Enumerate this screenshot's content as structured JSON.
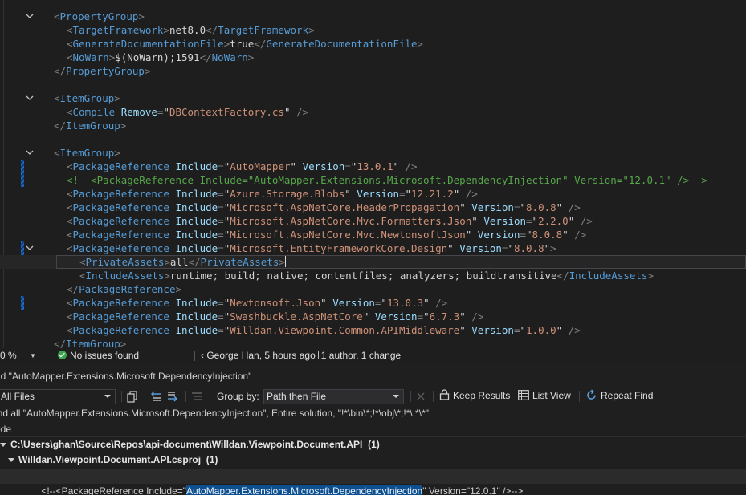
{
  "editor": {
    "lines": [
      {
        "fold": true,
        "indent": 0,
        "parts": [
          [
            "b",
            "<"
          ],
          [
            "t",
            "PropertyGroup"
          ],
          [
            "b",
            ">"
          ]
        ]
      },
      {
        "indent": 1,
        "parts": [
          [
            "b",
            "<"
          ],
          [
            "t",
            "TargetFramework"
          ],
          [
            "b",
            ">"
          ],
          [
            "x",
            "net8.0"
          ],
          [
            "b",
            "</"
          ],
          [
            "t",
            "TargetFramework"
          ],
          [
            "b",
            ">"
          ]
        ]
      },
      {
        "indent": 1,
        "parts": [
          [
            "b",
            "<"
          ],
          [
            "t",
            "GenerateDocumentationFile"
          ],
          [
            "b",
            ">"
          ],
          [
            "x",
            "true"
          ],
          [
            "b",
            "</"
          ],
          [
            "t",
            "GenerateDocumentationFile"
          ],
          [
            "b",
            ">"
          ]
        ]
      },
      {
        "indent": 1,
        "parts": [
          [
            "b",
            "<"
          ],
          [
            "t",
            "NoWarn"
          ],
          [
            "b",
            ">"
          ],
          [
            "x",
            "$(NoWarn);1591"
          ],
          [
            "b",
            "</"
          ],
          [
            "t",
            "NoWarn"
          ],
          [
            "b",
            ">"
          ]
        ]
      },
      {
        "indent": 0,
        "parts": [
          [
            "b",
            "</"
          ],
          [
            "t",
            "PropertyGroup"
          ],
          [
            "b",
            ">"
          ]
        ]
      },
      {
        "indent": 0,
        "parts": []
      },
      {
        "fold": true,
        "indent": 0,
        "parts": [
          [
            "b",
            "<"
          ],
          [
            "t",
            "ItemGroup"
          ],
          [
            "b",
            ">"
          ]
        ]
      },
      {
        "indent": 1,
        "parts": [
          [
            "b",
            "<"
          ],
          [
            "t",
            "Compile"
          ],
          [
            "x",
            " "
          ],
          [
            "a",
            "Remove"
          ],
          [
            "b",
            "="
          ],
          [
            "x",
            "\""
          ],
          [
            "v",
            "DBContextFactory.cs"
          ],
          [
            "x",
            "\""
          ],
          [
            "x",
            " "
          ],
          [
            "b",
            "/>"
          ]
        ]
      },
      {
        "indent": 0,
        "parts": [
          [
            "b",
            "</"
          ],
          [
            "t",
            "ItemGroup"
          ],
          [
            "b",
            ">"
          ]
        ]
      },
      {
        "indent": 0,
        "parts": []
      },
      {
        "fold": true,
        "indent": 0,
        "parts": [
          [
            "b",
            "<"
          ],
          [
            "t",
            "ItemGroup"
          ],
          [
            "b",
            ">"
          ]
        ]
      },
      {
        "mark": true,
        "indent": 1,
        "parts": [
          [
            "b",
            "<"
          ],
          [
            "t",
            "PackageReference"
          ],
          [
            "x",
            " "
          ],
          [
            "a",
            "Include"
          ],
          [
            "b",
            "="
          ],
          [
            "x",
            "\""
          ],
          [
            "v",
            "AutoMapper"
          ],
          [
            "x",
            "\""
          ],
          [
            "x",
            " "
          ],
          [
            "a",
            "Version"
          ],
          [
            "b",
            "="
          ],
          [
            "x",
            "\""
          ],
          [
            "v",
            "13.0.1"
          ],
          [
            "x",
            "\""
          ],
          [
            "x",
            " "
          ],
          [
            "b",
            "/>"
          ]
        ]
      },
      {
        "mark": true,
        "indent": 1,
        "parts": [
          [
            "c",
            "<!--<PackageReference Include=\"AutoMapper.Extensions.Microsoft.DependencyInjection\" Version=\"12.0.1\" />-->"
          ]
        ]
      },
      {
        "indent": 1,
        "parts": [
          [
            "b",
            "<"
          ],
          [
            "t",
            "PackageReference"
          ],
          [
            "x",
            " "
          ],
          [
            "a",
            "Include"
          ],
          [
            "b",
            "="
          ],
          [
            "x",
            "\""
          ],
          [
            "v",
            "Azure.Storage.Blobs"
          ],
          [
            "x",
            "\""
          ],
          [
            "x",
            " "
          ],
          [
            "a",
            "Version"
          ],
          [
            "b",
            "="
          ],
          [
            "x",
            "\""
          ],
          [
            "v",
            "12.21.2"
          ],
          [
            "x",
            "\""
          ],
          [
            "x",
            " "
          ],
          [
            "b",
            "/>"
          ]
        ]
      },
      {
        "indent": 1,
        "parts": [
          [
            "b",
            "<"
          ],
          [
            "t",
            "PackageReference"
          ],
          [
            "x",
            " "
          ],
          [
            "a",
            "Include"
          ],
          [
            "b",
            "="
          ],
          [
            "x",
            "\""
          ],
          [
            "v",
            "Microsoft.AspNetCore.HeaderPropagation"
          ],
          [
            "x",
            "\""
          ],
          [
            "x",
            " "
          ],
          [
            "a",
            "Version"
          ],
          [
            "b",
            "="
          ],
          [
            "x",
            "\""
          ],
          [
            "v",
            "8.0.8"
          ],
          [
            "x",
            "\""
          ],
          [
            "x",
            " "
          ],
          [
            "b",
            "/>"
          ]
        ]
      },
      {
        "indent": 1,
        "parts": [
          [
            "b",
            "<"
          ],
          [
            "t",
            "PackageReference"
          ],
          [
            "x",
            " "
          ],
          [
            "a",
            "Include"
          ],
          [
            "b",
            "="
          ],
          [
            "x",
            "\""
          ],
          [
            "v",
            "Microsoft.AspNetCore.Mvc.Formatters.Json"
          ],
          [
            "x",
            "\""
          ],
          [
            "x",
            " "
          ],
          [
            "a",
            "Version"
          ],
          [
            "b",
            "="
          ],
          [
            "x",
            "\""
          ],
          [
            "v",
            "2.2.0"
          ],
          [
            "x",
            "\""
          ],
          [
            "x",
            " "
          ],
          [
            "b",
            "/>"
          ]
        ]
      },
      {
        "indent": 1,
        "parts": [
          [
            "b",
            "<"
          ],
          [
            "t",
            "PackageReference"
          ],
          [
            "x",
            " "
          ],
          [
            "a",
            "Include"
          ],
          [
            "b",
            "="
          ],
          [
            "x",
            "\""
          ],
          [
            "v",
            "Microsoft.AspNetCore.Mvc.NewtonsoftJson"
          ],
          [
            "x",
            "\""
          ],
          [
            "x",
            " "
          ],
          [
            "a",
            "Version"
          ],
          [
            "b",
            "="
          ],
          [
            "x",
            "\""
          ],
          [
            "v",
            "8.0.8"
          ],
          [
            "x",
            "\""
          ],
          [
            "x",
            " "
          ],
          [
            "b",
            "/>"
          ]
        ]
      },
      {
        "fold": true,
        "mark": true,
        "indent": 1,
        "parts": [
          [
            "b",
            "<"
          ],
          [
            "t",
            "PackageReference"
          ],
          [
            "x",
            " "
          ],
          [
            "a",
            "Include"
          ],
          [
            "b",
            "="
          ],
          [
            "x",
            "\""
          ],
          [
            "v",
            "Microsoft.EntityFrameworkCore.Design"
          ],
          [
            "x",
            "\""
          ],
          [
            "x",
            " "
          ],
          [
            "a",
            "Version"
          ],
          [
            "b",
            "="
          ],
          [
            "x",
            "\""
          ],
          [
            "v",
            "8.0.8"
          ],
          [
            "x",
            "\""
          ],
          [
            "b",
            ">"
          ]
        ]
      },
      {
        "current": true,
        "indent": 2,
        "parts": [
          [
            "b",
            "<"
          ],
          [
            "t",
            "PrivateAssets"
          ],
          [
            "b",
            ">"
          ],
          [
            "x",
            "all"
          ],
          [
            "b",
            "</"
          ],
          [
            "t",
            "PrivateAssets"
          ],
          [
            "b",
            ">"
          ]
        ]
      },
      {
        "indent": 2,
        "parts": [
          [
            "b",
            "<"
          ],
          [
            "t",
            "IncludeAssets"
          ],
          [
            "b",
            ">"
          ],
          [
            "x",
            "runtime; build; native; contentfiles; analyzers; buildtransitive"
          ],
          [
            "b",
            "</"
          ],
          [
            "t",
            "IncludeAssets"
          ],
          [
            "b",
            ">"
          ]
        ]
      },
      {
        "indent": 1,
        "parts": [
          [
            "b",
            "</"
          ],
          [
            "t",
            "PackageReference"
          ],
          [
            "b",
            ">"
          ]
        ]
      },
      {
        "mark": true,
        "indent": 1,
        "parts": [
          [
            "b",
            "<"
          ],
          [
            "t",
            "PackageReference"
          ],
          [
            "x",
            " "
          ],
          [
            "a",
            "Include"
          ],
          [
            "b",
            "="
          ],
          [
            "x",
            "\""
          ],
          [
            "v",
            "Newtonsoft.Json"
          ],
          [
            "x",
            "\""
          ],
          [
            "x",
            " "
          ],
          [
            "a",
            "Version"
          ],
          [
            "b",
            "="
          ],
          [
            "x",
            "\""
          ],
          [
            "v",
            "13.0.3"
          ],
          [
            "x",
            "\""
          ],
          [
            "x",
            " "
          ],
          [
            "b",
            "/>"
          ]
        ]
      },
      {
        "indent": 1,
        "parts": [
          [
            "b",
            "<"
          ],
          [
            "t",
            "PackageReference"
          ],
          [
            "x",
            " "
          ],
          [
            "a",
            "Include"
          ],
          [
            "b",
            "="
          ],
          [
            "x",
            "\""
          ],
          [
            "v",
            "Swashbuckle.AspNetCore"
          ],
          [
            "x",
            "\""
          ],
          [
            "x",
            " "
          ],
          [
            "a",
            "Version"
          ],
          [
            "b",
            "="
          ],
          [
            "x",
            "\""
          ],
          [
            "v",
            "6.7.3"
          ],
          [
            "x",
            "\""
          ],
          [
            "x",
            " "
          ],
          [
            "b",
            "/>"
          ]
        ]
      },
      {
        "indent": 1,
        "parts": [
          [
            "b",
            "<"
          ],
          [
            "t",
            "PackageReference"
          ],
          [
            "x",
            " "
          ],
          [
            "a",
            "Include"
          ],
          [
            "b",
            "="
          ],
          [
            "x",
            "\""
          ],
          [
            "v",
            "Willdan.Viewpoint.Common.APIMiddleware"
          ],
          [
            "x",
            "\""
          ],
          [
            "x",
            " "
          ],
          [
            "a",
            "Version"
          ],
          [
            "b",
            "="
          ],
          [
            "x",
            "\""
          ],
          [
            "v",
            "1.0.0"
          ],
          [
            "x",
            "\""
          ],
          [
            "x",
            " "
          ],
          [
            "b",
            "/>"
          ]
        ]
      },
      {
        "indent": 0,
        "parts": [
          [
            "b",
            "</"
          ],
          [
            "t",
            "ItemGroup"
          ],
          [
            "b",
            ">"
          ]
        ]
      }
    ]
  },
  "status_bar": {
    "zoom": "0 %",
    "issues": "No issues found",
    "blame_author": "George Han, 5 hours ago",
    "blame_summary": "1 author, 1 change"
  },
  "find_panel": {
    "title": "nd \"AutoMapper.Extensions.Microsoft.DependencyInjection\"",
    "scope": "All Files",
    "group_by_label": "Group by:",
    "group_by_value": "Path then File",
    "keep_results": "Keep Results",
    "list_view": "List View",
    "repeat_find": "Repeat Find",
    "summary": "ind all \"AutoMapper.Extensions.Microsoft.DependencyInjection\", Entire solution, \"!*\\bin\\*;!*\\obj\\*;!*\\.*\\*\"",
    "column_header": "ode",
    "folder": "C:\\Users\\ghan\\Source\\Repos\\api-document\\Willdan.Viewpoint.Document.API",
    "folder_count": "(1)",
    "project": "Willdan.Viewpoint.Document.API.csproj",
    "project_count": "(1)",
    "result_prefix": "<!--<PackageReference Include=\"",
    "result_match": "AutoMapper.Extensions.Microsoft.DependencyInjection",
    "result_suffix": "\" Version=\"12.0.1\" />-->"
  }
}
